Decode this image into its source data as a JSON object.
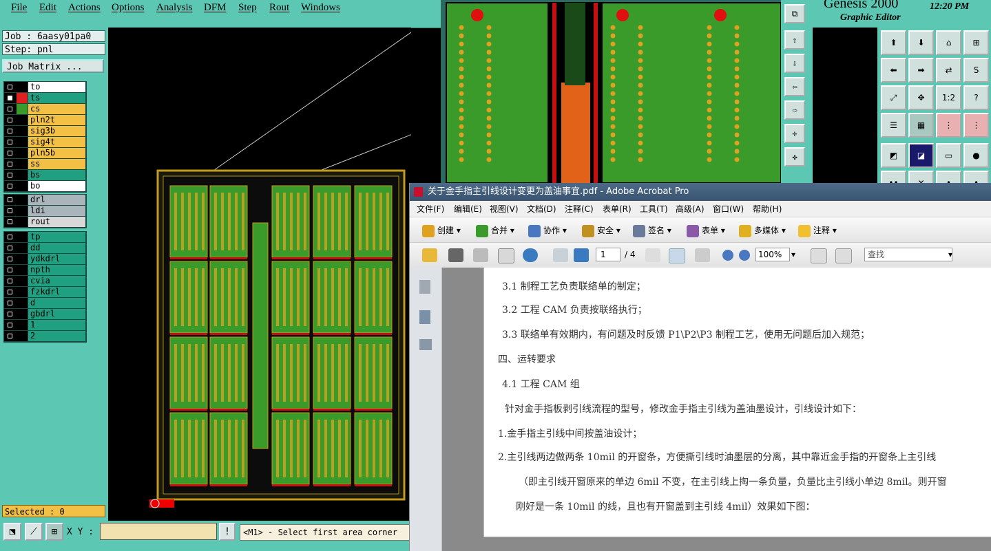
{
  "genesis": {
    "menu": [
      "File",
      "Edit",
      "Actions",
      "Options",
      "Analysis",
      "DFM",
      "Step",
      "Rout",
      "Windows"
    ],
    "job_label": "Job : 6aasy01pa0",
    "step_label": "Step: pnl",
    "job_matrix_label": "Job Matrix ...",
    "layers_group1": [
      {
        "name": "to",
        "color": "#ffffff",
        "swatch": "#000000",
        "selected": false
      },
      {
        "name": "ts",
        "color": "#20a080",
        "swatch": "#e02020",
        "selected": true
      },
      {
        "name": "cs",
        "color": "#f2c044",
        "swatch": "#3a9a2a",
        "selected": false
      },
      {
        "name": "pln2t",
        "color": "#f2c044",
        "swatch": "#000000",
        "selected": false
      },
      {
        "name": "sig3b",
        "color": "#f2c044",
        "swatch": "#000000",
        "selected": false
      },
      {
        "name": "sig4t",
        "color": "#f2c044",
        "swatch": "#000000",
        "selected": false
      },
      {
        "name": "pln5b",
        "color": "#f2c044",
        "swatch": "#000000",
        "selected": false
      },
      {
        "name": "ss",
        "color": "#f2c044",
        "swatch": "#000000",
        "selected": false
      },
      {
        "name": "bs",
        "color": "#20a080",
        "swatch": "#000000",
        "selected": false
      },
      {
        "name": "bo",
        "color": "#ffffff",
        "swatch": "#000000",
        "selected": false
      }
    ],
    "layers_group2": [
      {
        "name": "drl",
        "color": "#a9b4bb"
      },
      {
        "name": "ldi",
        "color": "#a9b4bb"
      },
      {
        "name": "rout",
        "color": "#d8d8d8"
      }
    ],
    "layers_group3": [
      {
        "name": "tp"
      },
      {
        "name": "dd"
      },
      {
        "name": "ydkdrl"
      },
      {
        "name": "npth"
      },
      {
        "name": "cvia"
      },
      {
        "name": "fzkdrl"
      },
      {
        "name": "d"
      },
      {
        "name": "gbdrl"
      },
      {
        "name": "1"
      },
      {
        "name": "2"
      }
    ],
    "selected_label": "Selected : 0",
    "xy_label": "X Y :",
    "xy_value": "",
    "prompt": "<M1> - Select first area corner",
    "title": "Genesis 2000",
    "subtitle": "Graphic Editor",
    "clock": "12:20 PM",
    "tool_labels": [
      "1:2",
      "?"
    ]
  },
  "acrobat": {
    "title": "关于金手指主引线设计变更为盖油事宜.pdf - Adobe Acrobat Pro",
    "menu": [
      "文件(F)",
      "编辑(E)",
      "视图(V)",
      "文档(D)",
      "注释(C)",
      "表单(R)",
      "工具(T)",
      "高级(A)",
      "窗口(W)",
      "帮助(H)"
    ],
    "toolbar": [
      "创建",
      "合并",
      "协作",
      "安全",
      "签名",
      "表单",
      "多媒体",
      "注释"
    ],
    "page_current": "1",
    "page_total": "/ 4",
    "zoom": "100%",
    "find_placeholder": "查找",
    "doc_lines": [
      "3.1  制程工艺负责联络单的制定；",
      "3.2  工程 CAM 负责按联络执行；",
      "3.3  联络单有效期内，有问题及时反馈 P1\\P2\\P3 制程工艺，使用无问题后加入规范；",
      "四、运转要求",
      "4.1 工程 CAM 组",
      "针对金手指板剥引线流程的型号，修改金手指主引线为盖油墨设计，引线设计如下：",
      "1.金手指主引线中间按盖油设计；",
      "2.主引线两边做两条 10mil 的开窗条，方便撕引线时油墨层的分离，其中靠近金手指的开窗条上主引线",
      "（即主引线开窗原来的单边 6mil 不变，在主引线上掏一条负量，负量比主引线小单边 8mil。则开窗",
      "刚好是一条 10mil 的线，且也有开窗盖到主引线 4mil）效果如下图："
    ]
  }
}
